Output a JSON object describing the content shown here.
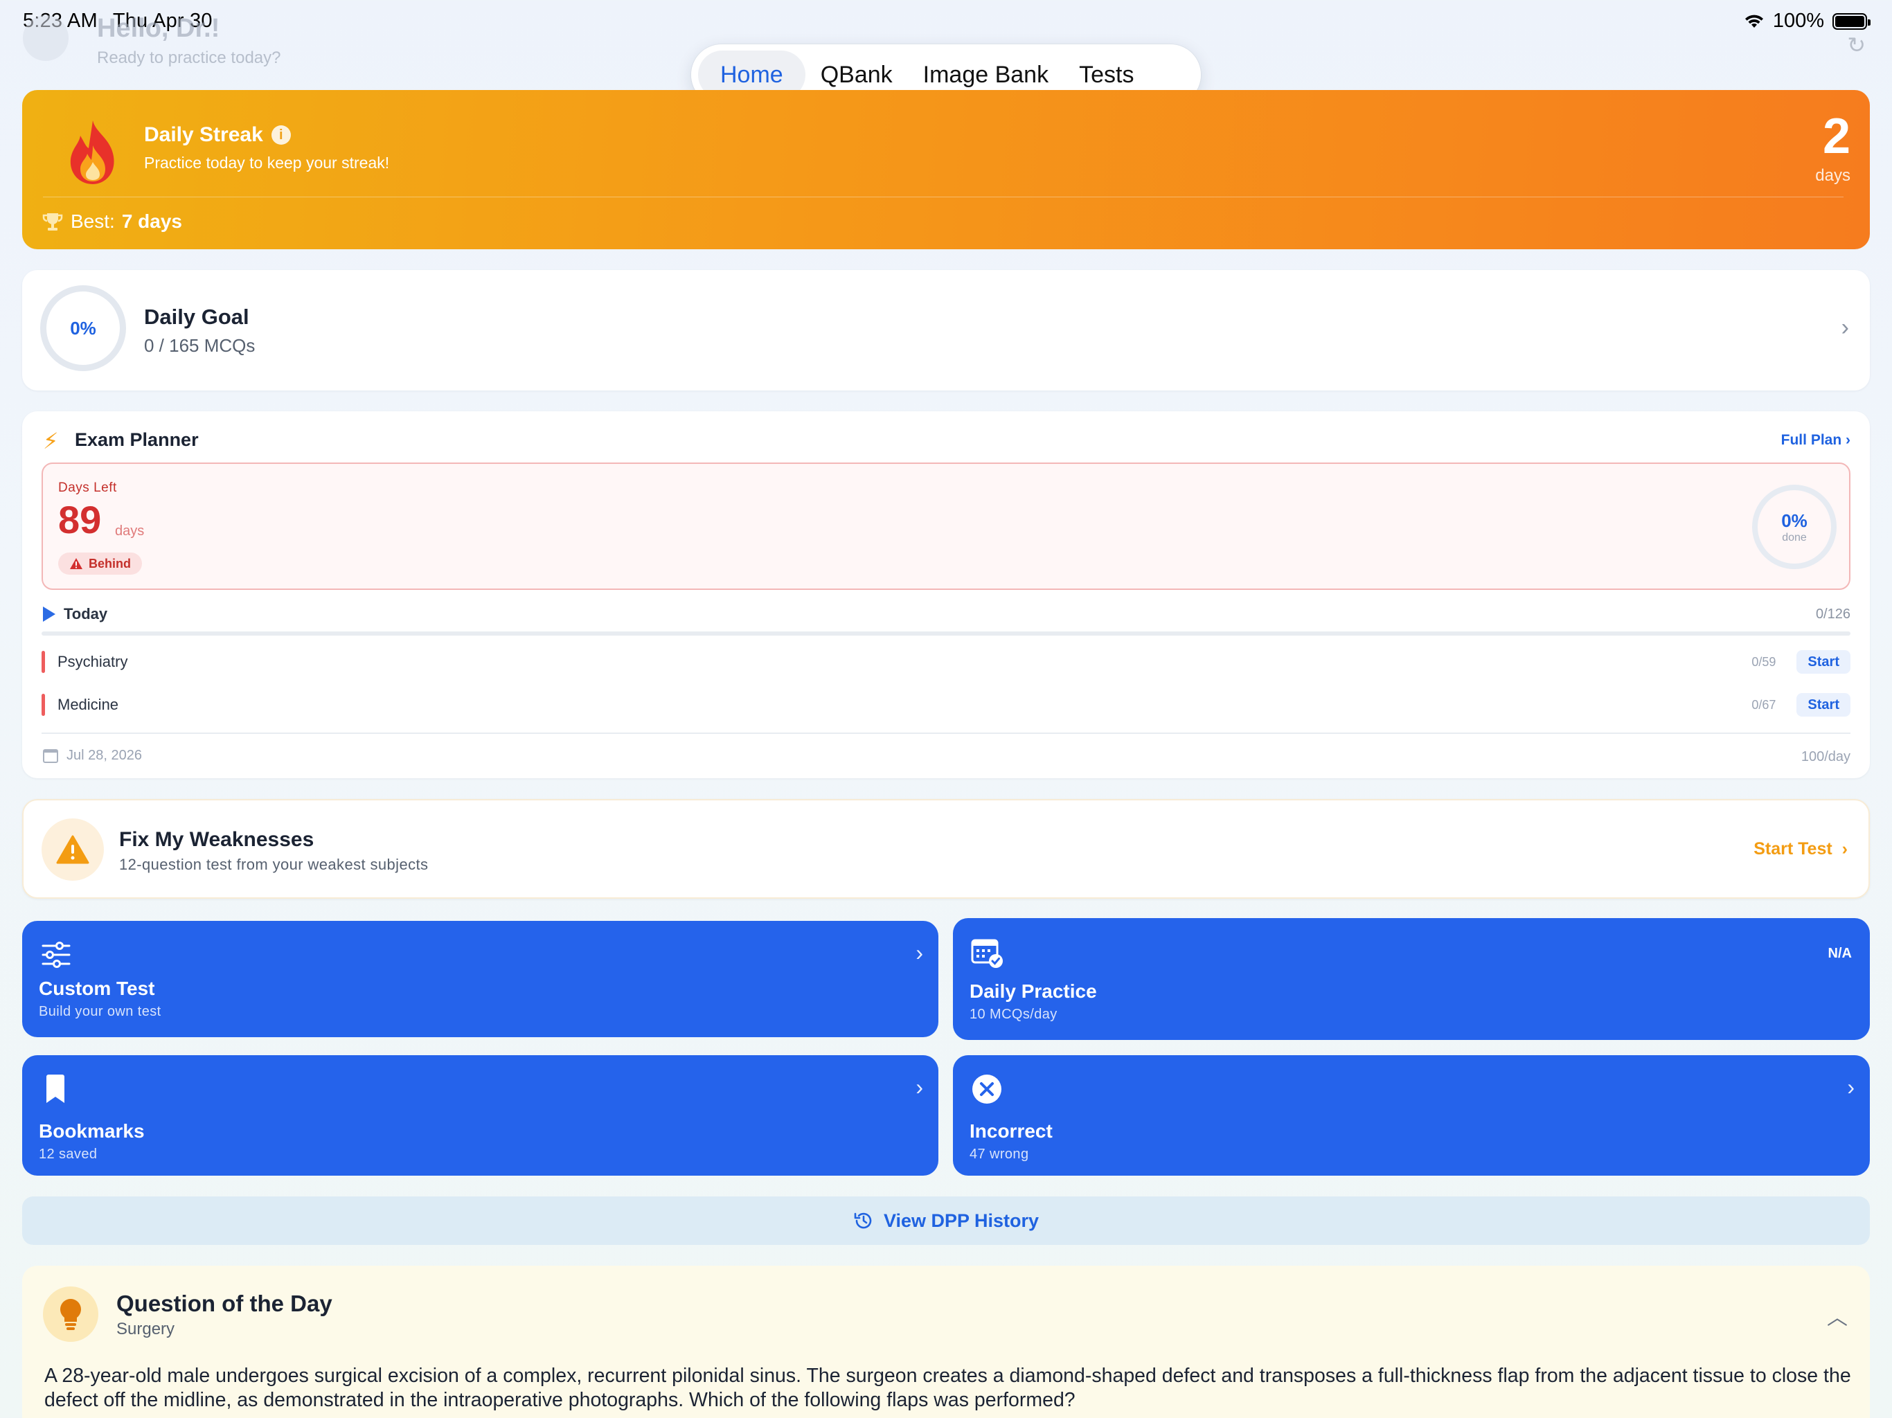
{
  "status_bar": {
    "time": "5:23 AM",
    "date": "Thu Apr 30",
    "battery": "100%"
  },
  "greeting": {
    "title": "Hello, Dr.!",
    "subtitle": "Ready to practice today?"
  },
  "tabs": [
    {
      "label": "Home",
      "active": true
    },
    {
      "label": "QBank",
      "active": false
    },
    {
      "label": "Image Bank",
      "active": false
    },
    {
      "label": "Tests",
      "active": false
    }
  ],
  "streak": {
    "title": "Daily Streak",
    "subtitle": "Practice today to keep your streak!",
    "best_label": "Best:",
    "best_value": "7 days",
    "count": "2",
    "unit": "days",
    "gradient_start": "#f0b013",
    "gradient_end": "#f67c1e"
  },
  "daily_goal": {
    "percent": "0%",
    "title": "Daily Goal",
    "progress": "0 / 165 MCQs"
  },
  "exam_planner": {
    "title": "Exam Planner",
    "full_plan": "Full Plan",
    "days_left_label": "Days Left",
    "days_left": "89",
    "days_unit": "days",
    "status": "Behind",
    "done_percent": "0%",
    "done_label": "done",
    "today_label": "Today",
    "today_count": "0/126",
    "subjects": [
      {
        "name": "Psychiatry",
        "count": "0/59",
        "action": "Start"
      },
      {
        "name": "Medicine",
        "count": "0/67",
        "action": "Start"
      }
    ],
    "exam_date": "Jul 28, 2026",
    "rate": "100/day"
  },
  "weakness": {
    "title": "Fix My Weaknesses",
    "subtitle": "12-question test from your weakest subjects",
    "action": "Start Test"
  },
  "tiles": {
    "custom": {
      "title": "Custom Test",
      "subtitle": "Build your own test"
    },
    "daily": {
      "title": "Daily Practice",
      "subtitle": "10 MCQs/day",
      "badge": "N/A"
    },
    "bookmarks": {
      "title": "Bookmarks",
      "subtitle": "12 saved"
    },
    "incorrect": {
      "title": "Incorrect",
      "subtitle": "47 wrong"
    },
    "color": "#2563eb"
  },
  "dpp_history": {
    "label": "View DPP History"
  },
  "qotd": {
    "title": "Question of the Day",
    "subject": "Surgery",
    "question": "A 28-year-old male undergoes surgical excision of a complex, recurrent pilonidal sinus. The surgeon creates a diamond-shaped defect and transposes a full-thickness flap from the adjacent tissue to close the defect off the midline, as demonstrated in the intraoperative photographs. Which of the following flaps was performed?"
  }
}
